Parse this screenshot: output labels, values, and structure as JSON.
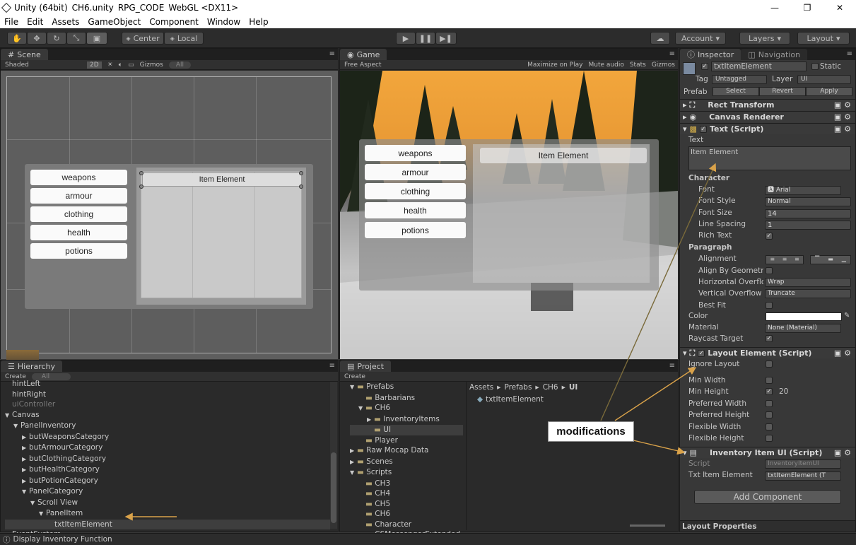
{
  "window": {
    "title_parts": [
      "Unity (64bit)",
      "CH6.unity",
      "RPG_CODE",
      "WebGL <DX11>"
    ],
    "controls": [
      "—",
      "❐",
      "✕"
    ]
  },
  "menu": [
    "File",
    "Edit",
    "Assets",
    "GameObject",
    "Component",
    "Window",
    "Help"
  ],
  "toolbar": {
    "center_label": "Center",
    "local_label": "Local",
    "account_label": "Account",
    "layers_label": "Layers",
    "layout_label": "Layout"
  },
  "scene": {
    "tab": "Scene",
    "shading": "Shaded",
    "mode_2d": "2D",
    "gizmos": "Gizmos",
    "search_placeholder": "All",
    "buttons": [
      "weapons",
      "armour",
      "clothing",
      "health",
      "potions"
    ],
    "item_element": "Item Element"
  },
  "game": {
    "tab": "Game",
    "aspect": "Free Aspect",
    "options": [
      "Maximize on Play",
      "Mute audio",
      "Stats",
      "Gizmos"
    ],
    "buttons": [
      "weapons",
      "armour",
      "clothing",
      "health",
      "potions"
    ],
    "item_element": "Item Element"
  },
  "hierarchy": {
    "tab": "Hierarchy",
    "create": "Create",
    "search_placeholder": "All",
    "items": [
      {
        "label": "hintLeft",
        "indent": 0
      },
      {
        "label": "hintRight",
        "indent": 0
      },
      {
        "label": "uiController",
        "indent": 0
      },
      {
        "label": "Canvas",
        "indent": 0
      },
      {
        "label": "PanelInventory",
        "indent": 1
      },
      {
        "label": "butWeaponsCategory",
        "indent": 2
      },
      {
        "label": "butArmourCategory",
        "indent": 2
      },
      {
        "label": "butClothingCategory",
        "indent": 2
      },
      {
        "label": "butHealthCategory",
        "indent": 2
      },
      {
        "label": "butPotionCategory",
        "indent": 2
      },
      {
        "label": "PanelCategory",
        "indent": 2
      },
      {
        "label": "Scroll View",
        "indent": 3
      },
      {
        "label": "PanelItem",
        "indent": 4
      },
      {
        "label": "txtItemElement",
        "indent": 5
      },
      {
        "label": "EventSystem",
        "indent": 0
      }
    ]
  },
  "project": {
    "tab": "Project",
    "create": "Create",
    "breadcrumb": [
      "Assets",
      "Prefabs",
      "CH6",
      "UI"
    ],
    "asset": "txtItemElement",
    "folders": [
      {
        "label": "Prefabs",
        "indent": 0
      },
      {
        "label": "Barbarians",
        "indent": 1
      },
      {
        "label": "CH6",
        "indent": 1
      },
      {
        "label": "InventoryItems",
        "indent": 2
      },
      {
        "label": "UI",
        "indent": 2
      },
      {
        "label": "Player",
        "indent": 1
      },
      {
        "label": "Raw Mocap Data",
        "indent": 0
      },
      {
        "label": "Scenes",
        "indent": 0
      },
      {
        "label": "Scripts",
        "indent": 0
      },
      {
        "label": "CH3",
        "indent": 1
      },
      {
        "label": "CH4",
        "indent": 1
      },
      {
        "label": "CH5",
        "indent": 1
      },
      {
        "label": "CH6",
        "indent": 1
      },
      {
        "label": "Character",
        "indent": 1
      },
      {
        "label": "CSMessengerExtended",
        "indent": 1
      }
    ]
  },
  "inspector": {
    "tab": "Inspector",
    "tab2": "Navigation",
    "object_name": "txtItemElement",
    "static_label": "Static",
    "tag_label": "Tag",
    "tag_value": "Untagged",
    "layer_label": "Layer",
    "layer_value": "UI",
    "prefab_label": "Prefab",
    "prefab_buttons": [
      "Select",
      "Revert",
      "Apply"
    ],
    "components": {
      "rect_transform": "Rect Transform",
      "canvas_renderer": "Canvas Renderer",
      "text_script": "Text (Script)",
      "layout_element": "Layout Element (Script)",
      "inventory_item": "Inventory Item UI (Script)"
    },
    "text_label": "Text",
    "text_value": "Item Element",
    "character_header": "Character",
    "font_label": "Font",
    "font_value": "Arial",
    "font_style_label": "Font Style",
    "font_style_value": "Normal",
    "font_size_label": "Font Size",
    "font_size_value": "14",
    "line_spacing_label": "Line Spacing",
    "line_spacing_value": "1",
    "rich_text_label": "Rich Text",
    "paragraph_header": "Paragraph",
    "alignment_label": "Alignment",
    "align_geometry_label": "Align By Geometry",
    "h_overflow_label": "Horizontal Overflow",
    "h_overflow_value": "Wrap",
    "v_overflow_label": "Vertical Overflow",
    "v_overflow_value": "Truncate",
    "best_fit_label": "Best Fit",
    "color_label": "Color",
    "material_label": "Material",
    "material_value": "None (Material)",
    "raycast_label": "Raycast Target",
    "layout_rows": [
      {
        "label": "Ignore Layout",
        "checked": false,
        "value": ""
      },
      {
        "label": "Min Width",
        "checked": false,
        "value": ""
      },
      {
        "label": "Min Height",
        "checked": true,
        "value": "20"
      },
      {
        "label": "Preferred Width",
        "checked": false,
        "value": ""
      },
      {
        "label": "Preferred Height",
        "checked": false,
        "value": ""
      },
      {
        "label": "Flexible Width",
        "checked": false,
        "value": ""
      },
      {
        "label": "Flexible Height",
        "checked": false,
        "value": ""
      }
    ],
    "script_label": "Script",
    "script_value": "InventoryItemUI",
    "txt_item_label": "Txt Item Element",
    "txt_item_value": "txtItemElement (T",
    "add_component": "Add Component",
    "layout_properties": "Layout Properties"
  },
  "annotation": "modifications",
  "status_bar": "Display Inventory Function",
  "colors": {
    "editor_bg": "#383838",
    "panel_dark": "#2a2a2a",
    "annotation_arrow": "#d9a24a",
    "sky_orange": "#f2a63c"
  }
}
